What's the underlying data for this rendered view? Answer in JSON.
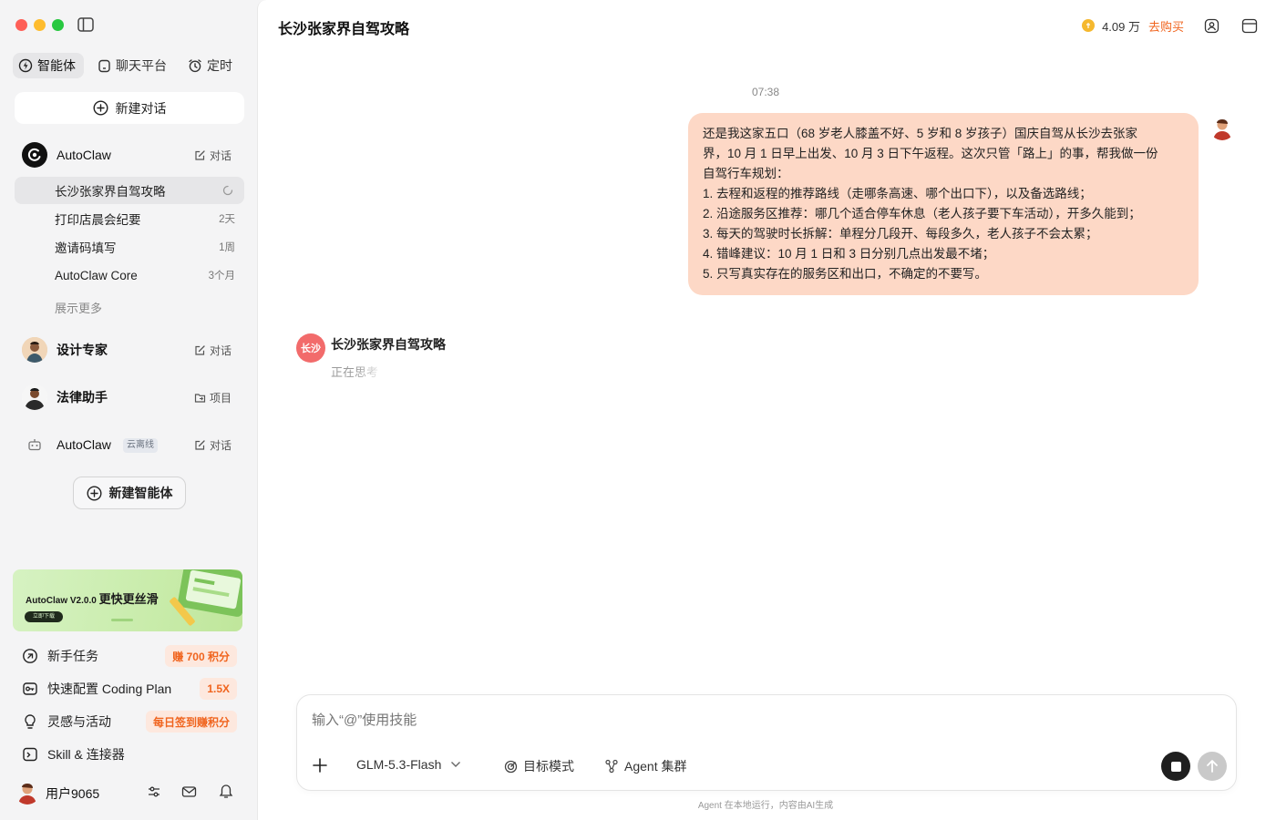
{
  "sidebar": {
    "tabs": [
      {
        "label": "智能体",
        "icon": "agent-icon"
      },
      {
        "label": "聊天平台",
        "icon": "chat-platform-icon"
      },
      {
        "label": "定时",
        "icon": "alarm-clock-icon"
      }
    ],
    "new_chat_label": "新建对话",
    "primary_agent": {
      "name": "AutoClaw",
      "action": "对话",
      "conversations": [
        {
          "title": "长沙张家界自驾攻略",
          "time": ""
        },
        {
          "title": "打印店晨会纪要",
          "time": "2天"
        },
        {
          "title": "邀请码填写",
          "time": "1周"
        },
        {
          "title": "AutoClaw Core",
          "time": "3个月"
        }
      ],
      "show_more": "展示更多"
    },
    "agents": [
      {
        "name": "设计专家",
        "action": "对话"
      },
      {
        "name": "法律助手",
        "action": "项目"
      },
      {
        "name": "AutoClaw",
        "tag": "云离线",
        "action": "对话"
      }
    ],
    "new_agent_label": "新建智能体",
    "banner": {
      "title_a": "AutoClaw V2.0.0",
      "title_b": "更快更丝滑",
      "button": "立即下载"
    },
    "bottom_items": [
      {
        "label": "新手任务",
        "badge": "赚 700 积分"
      },
      {
        "label": "快速配置 Coding Plan",
        "badge": "1.5X"
      },
      {
        "label": "灵感与活动",
        "badge": "每日签到赚积分"
      },
      {
        "label": "Skill & 连接器",
        "badge": ""
      }
    ],
    "user": {
      "name": "用户9065"
    }
  },
  "header": {
    "title": "长沙张家界自驾攻略",
    "credits": "4.09 万",
    "buy": "去购买",
    "colors": {
      "accent": "#f0641e",
      "coin": "#f5b82e"
    }
  },
  "chat": {
    "timestamp": "07:38",
    "user_message_lines": [
      "还是我这家五口（68 岁老人膝盖不好、5 岁和 8 岁孩子）国庆自驾从长沙去张家",
      "界，10 月 1 日早上出发、10 月 3 日下午返程。这次只管「路上」的事，帮我做一份",
      "自驾行车规划：",
      "1. 去程和返程的推荐路线（走哪条高速、哪个出口下），以及备选路线；",
      "2. 沿途服务区推荐：哪几个适合停车休息（老人孩子要下车活动），开多久能到；",
      "3. 每天的驾驶时长拆解：单程分几段开、每段多久，老人孩子不会太累；",
      "4. 错峰建议：10 月 1 日和 3 日分别几点出发最不堵；",
      "5. 只写真实存在的服务区和出口，不确定的不要写。"
    ],
    "assistant": {
      "avatar_text": "长沙",
      "name": "长沙张家界自驾攻略",
      "status": "正在思考"
    }
  },
  "composer": {
    "placeholder": "输入“@”使用技能",
    "model": "GLM-5.3-Flash",
    "goal_mode": "目标模式",
    "agent_cluster": "Agent 集群",
    "footer": "Agent 在本地运行，内容由AI生成"
  }
}
